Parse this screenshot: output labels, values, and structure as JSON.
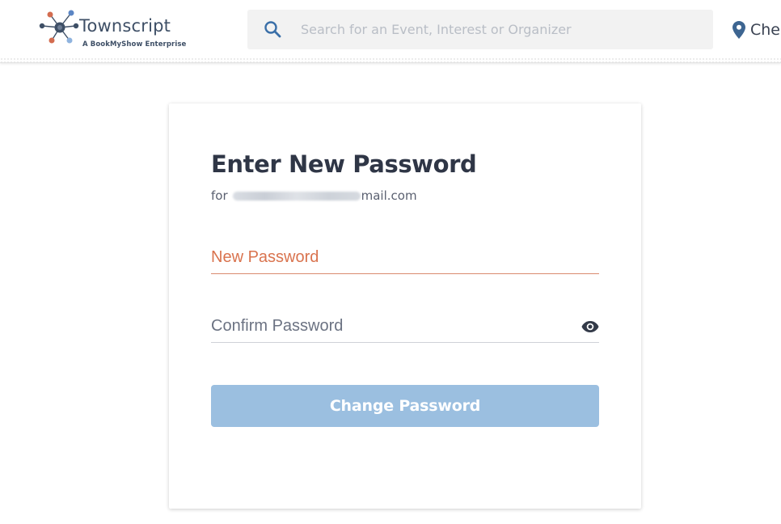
{
  "header": {
    "logo": {
      "name": "Townscript",
      "tagline": "A BookMyShow Enterprise"
    },
    "search": {
      "placeholder": "Search for an Event, Interest or Organizer"
    },
    "location": {
      "label": "Che"
    }
  },
  "form": {
    "title": "Enter New Password",
    "email_prefix": "for",
    "email_suffix": "mail.com",
    "new_password_label": "New Password",
    "confirm_password_label": "Confirm Password",
    "submit_label": "Change Password"
  },
  "colors": {
    "accent_orange": "#d9734e",
    "button_blue": "#9bbfe0",
    "title_text": "#2f3646"
  },
  "icons": [
    "townscript-logo-icon",
    "search-icon",
    "location-pin-icon",
    "eye-icon"
  ]
}
